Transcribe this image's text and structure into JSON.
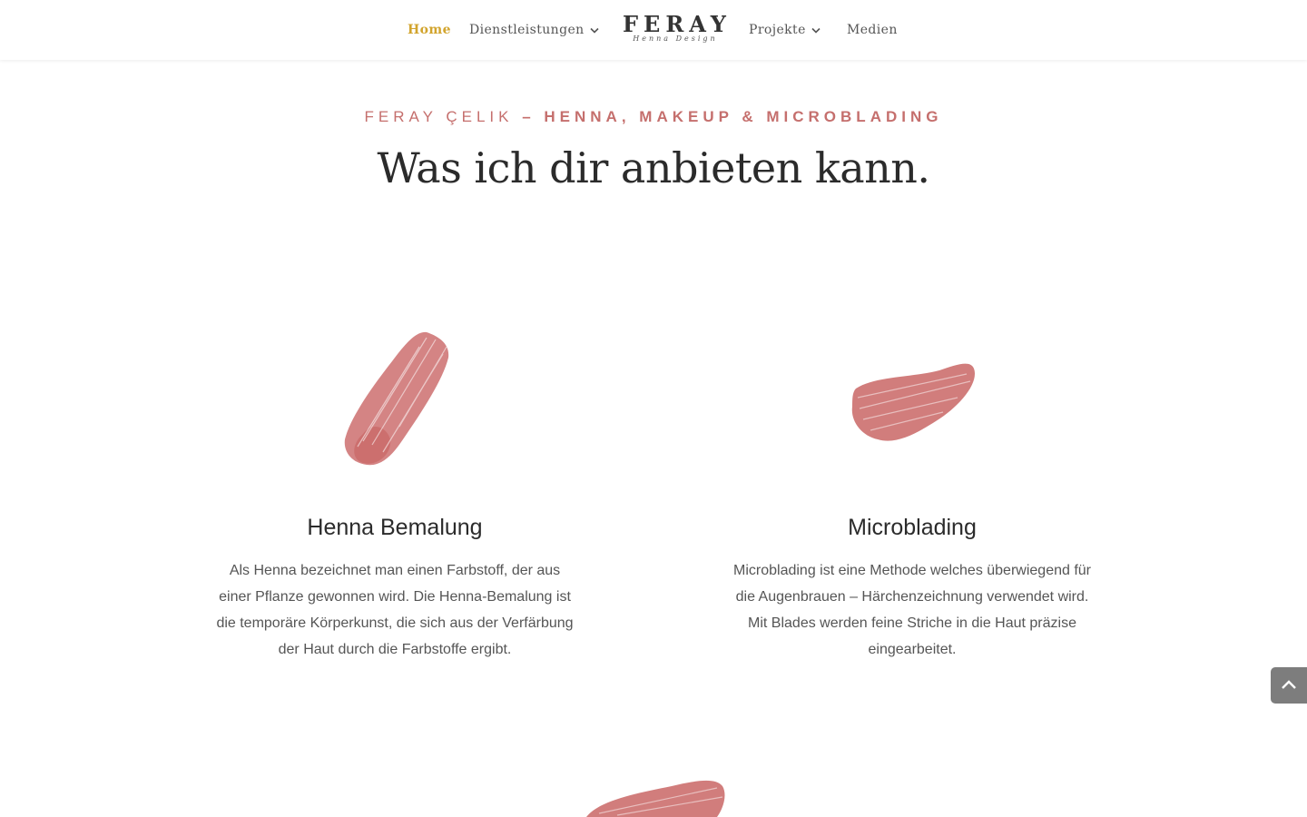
{
  "nav": {
    "items": [
      {
        "label": "Home",
        "active": true,
        "has_dropdown": false
      },
      {
        "label": "Dienstleistungen",
        "active": false,
        "has_dropdown": true
      },
      {
        "label": "Projekte",
        "active": false,
        "has_dropdown": true
      },
      {
        "label": "Medien",
        "active": false,
        "has_dropdown": false
      }
    ],
    "active_color": "#d2a42d"
  },
  "logo": {
    "text": "FERAY",
    "subtitle": "Henna Design"
  },
  "hero": {
    "kicker_name": "FERAY ÇELIK",
    "kicker_separator": " – ",
    "kicker_services": "HENNA, MAKEUP & MICROBLADING",
    "headline": "Was ich dir anbieten kann."
  },
  "services": [
    {
      "title": "Henna Bemalung",
      "text": "Als Henna bezeichnet man einen Farbstoff, der aus einer Pflanze gewonnen wird. Die Henna-Bemalung ist die temporäre Körperkunst, die sich aus der Verfärbung der Haut durch die Farbstoffe ergibt.",
      "icon": "brush-stroke-icon"
    },
    {
      "title": "Microblading",
      "text": "Microblading ist eine Methode welches überwiegend für die Augenbrauen – Härchenzeichnung verwendet wird. Mit Blades werden feine Striche in die Haut präzise eingearbeitet.",
      "icon": "brush-stroke-icon"
    }
  ],
  "colors": {
    "accent": "#c56f6d",
    "text": "#555555",
    "heading": "#2b2b2b"
  },
  "back_to_top": {
    "icon": "chevron-up-icon"
  }
}
